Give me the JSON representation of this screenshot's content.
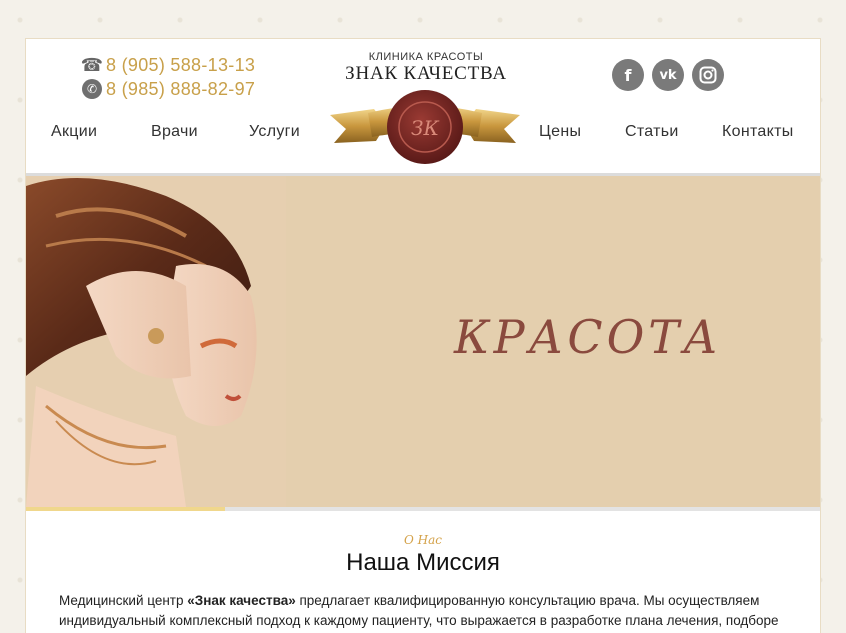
{
  "header": {
    "phones": [
      {
        "icon": "phone-icon",
        "number": "8 (905) 588-13-13"
      },
      {
        "icon": "whatsapp-icon",
        "number": "8 (985) 888-82-97"
      }
    ],
    "logo": {
      "subtitle": "КЛИНИКА КРАСОТЫ",
      "title": "ЗНАК КАЧЕСТВА",
      "seal_monogram": "ЗК"
    },
    "social": [
      {
        "name": "facebook-icon",
        "glyph": "f"
      },
      {
        "name": "vk-icon",
        "glyph": "vk"
      },
      {
        "name": "instagram-icon",
        "glyph": ""
      }
    ]
  },
  "nav": {
    "left": [
      "Акции",
      "Врачи",
      "Услуги"
    ],
    "right": [
      "Цены",
      "Статьи",
      "Контакты"
    ]
  },
  "hero": {
    "word": "КРАСОТА",
    "background_color": "#e4cfae",
    "word_color": "#8a4a3e",
    "slider_progress": 0.25
  },
  "about": {
    "kicker": "О Нас",
    "title": "Наша Миссия",
    "text_prefix": "Медицинский центр ",
    "brand": "«Знак качества»",
    "text_suffix": " предлагает квалифицированную консультацию врача. Мы осуществляем индивидуальный комплексный подход к каждому пациенту, что выражается в разработке плана лечения, подборе и"
  },
  "colors": {
    "accent_gold": "#c8a04a",
    "seal_red": "#7a2a26",
    "ribbon_gold": "#c9a04a"
  }
}
